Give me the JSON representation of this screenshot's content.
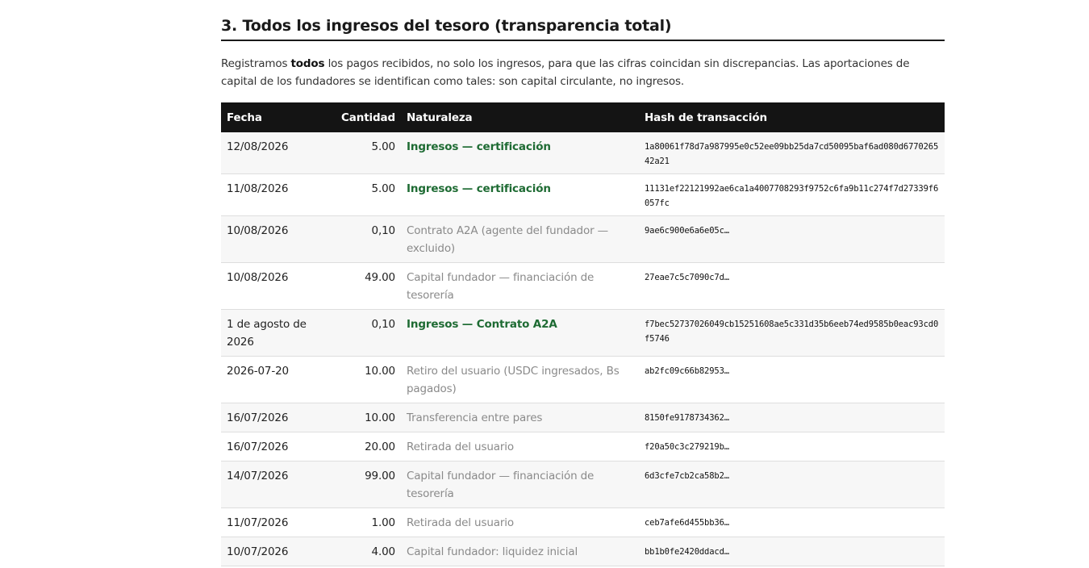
{
  "section": {
    "title": "3. Todos los ingresos del tesoro (transparencia total)",
    "intro_pre": "Registramos ",
    "intro_bold": "todos",
    "intro_post": " los pagos recibidos, no solo los ingresos, para que las cifras coincidan sin discrepancias. Las aportaciones de capital de los fundadores se identifican como tales: son capital circulante, no ingresos."
  },
  "table": {
    "headers": {
      "date": "Fecha",
      "amount": "Cantidad",
      "nature": "Naturaleza",
      "hash": "Hash de transacción"
    },
    "rows": [
      {
        "date": "12/08/2026",
        "amount": "5.00",
        "nature": "Ingresos — certificación",
        "income": true,
        "hash": "1a80061f78d7a987995e0c52ee09bb25da7cd50095baf6ad080d677026542a21"
      },
      {
        "date": "11/08/2026",
        "amount": "5.00",
        "nature": "Ingresos — certificación",
        "income": true,
        "hash": "11131ef22121992ae6ca1a4007708293f9752c6fa9b11c274f7d27339f6057fc"
      },
      {
        "date": "10/08/2026",
        "amount": "0,10",
        "nature": "Contrato A2A (agente del fundador — excluido)",
        "income": false,
        "hash": "9ae6c900e6a6e05c…"
      },
      {
        "date": "10/08/2026",
        "amount": "49.00",
        "nature": "Capital fundador — financiación de tesorería",
        "income": false,
        "hash": "27eae7c5c7090c7d…"
      },
      {
        "date": "1 de agosto de 2026",
        "amount": "0,10",
        "nature": "Ingresos — Contrato A2A",
        "income": true,
        "hash": "f7bec52737026049cb15251608ae5c331d35b6eeb74ed9585b0eac93cd0f5746"
      },
      {
        "date": "2026-07-20",
        "amount": "10.00",
        "nature": "Retiro del usuario (USDC ingresados, Bs pagados)",
        "income": false,
        "hash": "ab2fc09c66b82953…"
      },
      {
        "date": "16/07/2026",
        "amount": "10.00",
        "nature": "Transferencia entre pares",
        "income": false,
        "hash": "8150fe9178734362…"
      },
      {
        "date": "16/07/2026",
        "amount": "20.00",
        "nature": "Retirada del usuario",
        "income": false,
        "hash": "f20a50c3c279219b…"
      },
      {
        "date": "14/07/2026",
        "amount": "99.00",
        "nature": "Capital fundador — financiación de tesorería",
        "income": false,
        "hash": "6d3cfe7cb2ca58b2…"
      },
      {
        "date": "11/07/2026",
        "amount": "1.00",
        "nature": "Retirada del usuario",
        "income": false,
        "hash": "ceb7afe6d455bb36…"
      },
      {
        "date": "10/07/2026",
        "amount": "4.00",
        "nature": "Capital fundador: liquidez inicial",
        "income": false,
        "hash": "bb1b0fe2420ddacd…"
      }
    ]
  },
  "colors": {
    "income_text": "#1e6b33",
    "muted_text": "#8a8a8a",
    "header_bg": "#141414"
  }
}
